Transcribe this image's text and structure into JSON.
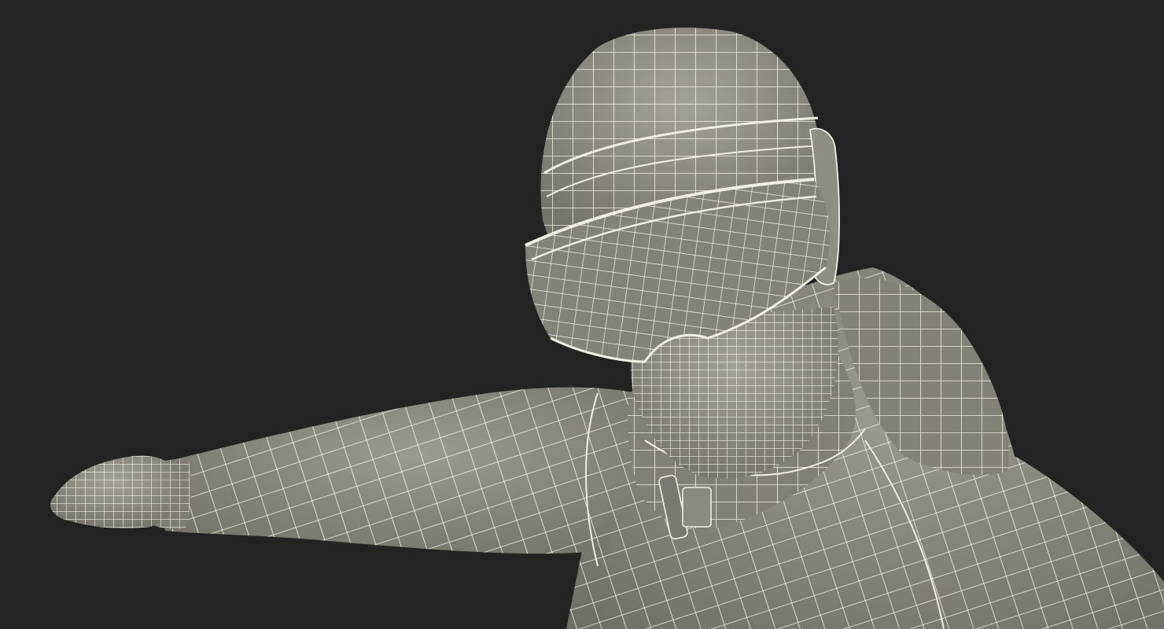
{
  "viewport": {
    "background_color": "#232323",
    "render_style": "wireframe-on-shaded",
    "model_description_icon": "snowboarder-wireframe-figure",
    "colors": {
      "surface": "#8a8a80",
      "surface_light": "#a4a49a",
      "surface_dark": "#6c6c64",
      "wire": "#f1efe3"
    }
  }
}
